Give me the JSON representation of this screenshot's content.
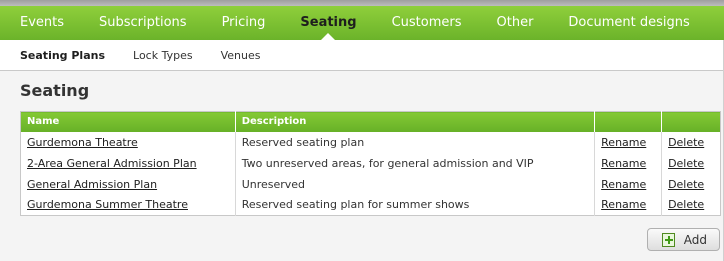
{
  "main_nav": {
    "items": [
      {
        "label": "Events"
      },
      {
        "label": "Subscriptions"
      },
      {
        "label": "Pricing"
      },
      {
        "label": "Seating"
      },
      {
        "label": "Customers"
      },
      {
        "label": "Other"
      },
      {
        "label": "Document designs"
      }
    ],
    "active": "Seating"
  },
  "sub_nav": {
    "items": [
      {
        "label": "Seating Plans"
      },
      {
        "label": "Lock Types"
      },
      {
        "label": "Venues"
      }
    ],
    "active": "Seating Plans"
  },
  "page": {
    "title": "Seating"
  },
  "table": {
    "headers": {
      "name": "Name",
      "description": "Description",
      "rename": "",
      "delete": ""
    },
    "rows": [
      {
        "name": "Gurdemona Theatre",
        "description": "Reserved seating plan",
        "rename": "Rename",
        "delete": "Delete"
      },
      {
        "name": "2-Area General Admission Plan",
        "description": "Two unreserved areas, for general admission and VIP",
        "rename": "Rename",
        "delete": "Delete"
      },
      {
        "name": "General Admission Plan",
        "description": "Unreserved",
        "rename": "Rename",
        "delete": "Delete"
      },
      {
        "name": "Gurdemona Summer Theatre",
        "description": "Reserved seating plan for summer shows",
        "rename": "Rename",
        "delete": "Delete"
      }
    ]
  },
  "actions": {
    "add_label": "Add",
    "add_icon": "plus-icon"
  },
  "colors": {
    "nav_green": "#79bf30",
    "header_green": "#74bc2e",
    "active_text": "#1e1e1e"
  }
}
